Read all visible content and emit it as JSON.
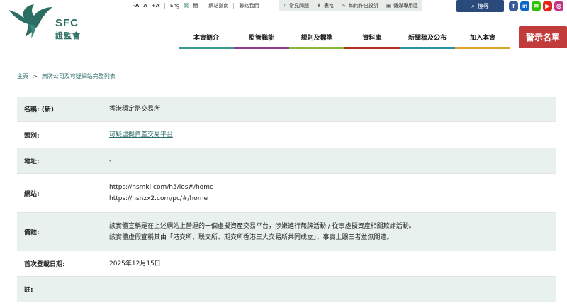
{
  "header": {
    "logo_text": "SFC",
    "logo_cn": "證監會",
    "font_controls": [
      "-A",
      "A",
      "+A"
    ],
    "languages": [
      "Eng",
      "繁",
      "簡"
    ],
    "site_map": "網站指南",
    "contact": "聯絡我們",
    "quick_links": [
      {
        "icon": "question-icon",
        "label": "常見問題"
      },
      {
        "icon": "download-icon",
        "label": "表格"
      },
      {
        "icon": "megaphone-icon",
        "label": "如何作出投訴"
      },
      {
        "icon": "image-icon",
        "label": "傳媒專用區"
      }
    ],
    "search_label": "搜尋",
    "social": [
      {
        "icon": "facebook-icon",
        "glyph": "f",
        "color": "#3b5998"
      },
      {
        "icon": "linkedin-icon",
        "glyph": "in",
        "color": "#0a66c2"
      },
      {
        "icon": "wechat-icon",
        "glyph": "✉",
        "color": "#2dc100"
      },
      {
        "icon": "youtube-icon",
        "glyph": "▶",
        "color": "#e62117"
      },
      {
        "icon": "instagram-icon",
        "glyph": "◎",
        "color": "#c13584"
      }
    ],
    "nav": [
      {
        "label": "本會簡介",
        "color": "#3a9c8f"
      },
      {
        "label": "監管職能",
        "color": "#8e3d93"
      },
      {
        "label": "規則及標準",
        "color": "#8cb63c"
      },
      {
        "label": "資料庫",
        "color": "#b8321f"
      },
      {
        "label": "新聞稿及公布",
        "color": "#2a8fa6"
      },
      {
        "label": "加入本會",
        "color": "#d9a62a"
      }
    ],
    "alert_button": "警示名單"
  },
  "breadcrumb": {
    "home": "主頁",
    "separator": ">",
    "current": "無牌公司及可疑網站完整列表"
  },
  "details": [
    {
      "label": "名稱: (新)",
      "lines": [
        "香港穩定幣交易所"
      ],
      "link": false,
      "shaded": true,
      "height": 36
    },
    {
      "label": "類別:",
      "lines": [
        "可疑虛擬資產交易平台"
      ],
      "link": true,
      "shaded": false,
      "height": 36
    },
    {
      "label": "地址:",
      "lines": [
        "-"
      ],
      "link": false,
      "shaded": true,
      "height": 36
    },
    {
      "label": "網站:",
      "lines": [
        "https://hsmkl.com/h5/ios#/home",
        "https://hsnzx2.com/pc/#/home"
      ],
      "link": false,
      "shaded": false,
      "height": 55
    },
    {
      "label": "備註:",
      "lines": [
        "該實體宣稱是在上述網站上營運的一個虛擬資產交易平台，涉嫌進行無牌活動 / 從事虛擬資產相關欺詐活動。",
        "該實體虛假宣稱其由「港交所、联交所、期交所香港三大交易所共同成立」，事實上跟三者並無關連。"
      ],
      "link": false,
      "shaded": true,
      "height": 54
    },
    {
      "label": "首次登載日期:",
      "lines": [
        "2025年12月15日"
      ],
      "link": false,
      "shaded": false,
      "height": 36
    },
    {
      "label": "註:",
      "lines": [
        ""
      ],
      "link": false,
      "shaded": true,
      "height": 36
    }
  ]
}
